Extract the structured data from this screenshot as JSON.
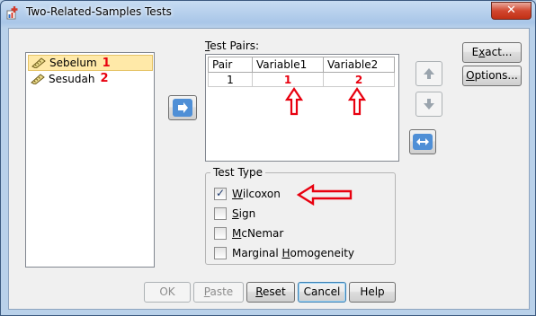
{
  "window": {
    "title": "Two-Related-Samples Tests",
    "close_glyph": "✕"
  },
  "variables": [
    {
      "name": "Sebelum",
      "marker": "1",
      "selected": true
    },
    {
      "name": "Sesudah",
      "marker": "2",
      "selected": false
    }
  ],
  "test_pairs": {
    "label": "Test Pairs:",
    "columns": [
      "Pair",
      "Variable1",
      "Variable2"
    ],
    "rows": [
      {
        "pair": "1",
        "variable1": "1",
        "variable2": "2"
      }
    ]
  },
  "test_type": {
    "legend": "Test Type",
    "options": [
      {
        "label": "Wilcoxon",
        "underline": "W",
        "rest": "ilcoxon",
        "checked": true
      },
      {
        "label": "Sign",
        "underline": "S",
        "rest": "ign",
        "checked": false
      },
      {
        "label": "McNemar",
        "underline": "M",
        "rest": "cNemar",
        "checked": false
      },
      {
        "pre": "Marginal ",
        "underline": "H",
        "rest": "omogeneity",
        "label": "Marginal Homogeneity",
        "checked": false
      }
    ]
  },
  "side_buttons": {
    "exact": {
      "pre": "E",
      "underline": "x",
      "rest": "act..."
    },
    "options": {
      "pre": "",
      "underline": "O",
      "rest": "ptions..."
    }
  },
  "bottom_buttons": {
    "ok": "OK",
    "paste": {
      "underline": "P",
      "rest": "aste"
    },
    "reset": {
      "underline": "R",
      "rest": "eset"
    },
    "cancel": "Cancel",
    "help": "Help"
  },
  "colors": {
    "annotation_red": "#e8000f",
    "accent_blue": "#2a6cc6"
  }
}
